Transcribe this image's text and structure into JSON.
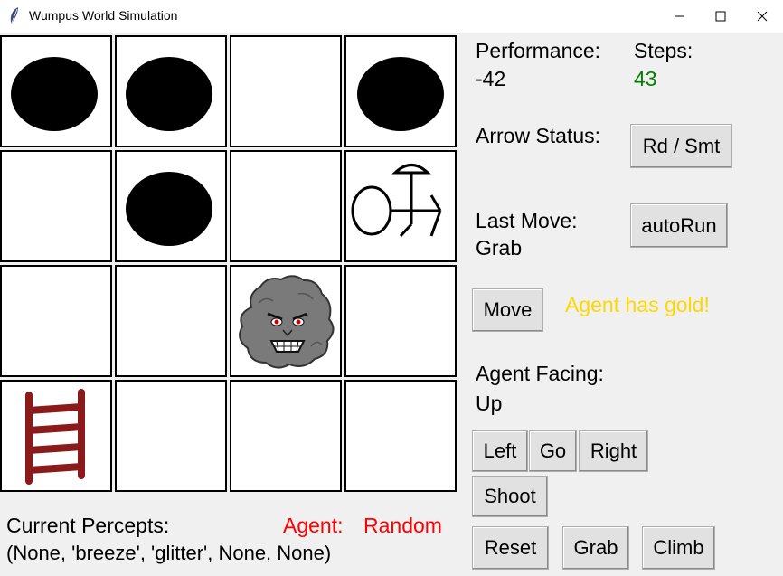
{
  "window": {
    "title": "Wumpus World Simulation"
  },
  "status": {
    "performance_label": "Performance:",
    "performance_value": "-42",
    "steps_label": "Steps:",
    "steps_value": "43",
    "arrow_label": "Arrow Status:",
    "last_move_label": "Last Move:",
    "last_move_value": "Grab",
    "gold_message": "Agent has gold!",
    "facing_label": "Agent Facing:",
    "facing_value": "Up"
  },
  "buttons": {
    "arrow": "Rd / Smt",
    "autorun": "autoRun",
    "move": "Move",
    "left": "Left",
    "go": "Go",
    "right": "Right",
    "shoot": "Shoot",
    "reset": "Reset",
    "grab": "Grab",
    "climb": "Climb"
  },
  "percepts": {
    "label": "Current Percepts:",
    "value": "(None, 'breeze', 'glitter', None, None)"
  },
  "agent": {
    "label": "Agent:",
    "name": "Random"
  },
  "board": {
    "rows": [
      [
        "pit",
        "pit",
        "empty",
        "pit"
      ],
      [
        "empty",
        "pit",
        "empty",
        "agent"
      ],
      [
        "empty",
        "empty",
        "wumpus",
        "empty"
      ],
      [
        "ladder",
        "empty",
        "empty",
        "empty"
      ]
    ]
  },
  "colors": {
    "steps": "#008000",
    "gold_message": "#ffd700",
    "agent": "#ff0000",
    "ladder": "#8b1a1a",
    "wumpus_eyes": "#cc0000"
  }
}
